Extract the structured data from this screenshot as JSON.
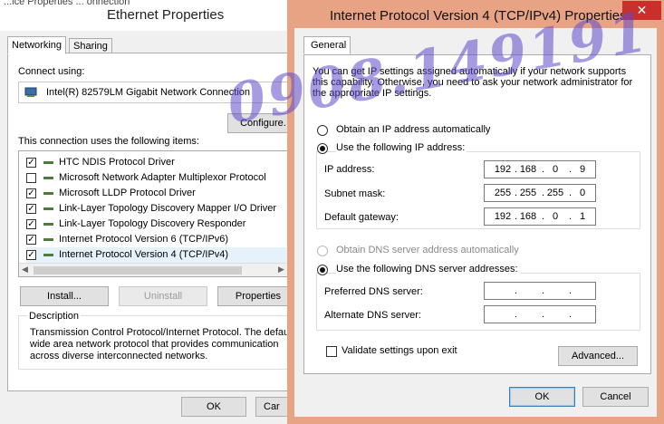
{
  "background_dialog": {
    "top_fragment": "...ice Properties ... onnection",
    "title": "Ethernet Properties",
    "tabs": [
      "Networking",
      "Sharing"
    ],
    "connect_using_label": "Connect using:",
    "adapter_name": "Intel(R) 82579LM Gigabit Network Connection",
    "configure_label": "Configure.",
    "items_label": "This connection uses the following items:",
    "items": [
      {
        "checked": true,
        "label": "HTC NDIS Protocol Driver"
      },
      {
        "checked": false,
        "label": "Microsoft Network Adapter Multiplexor Protocol"
      },
      {
        "checked": true,
        "label": "Microsoft LLDP Protocol Driver"
      },
      {
        "checked": true,
        "label": "Link-Layer Topology Discovery Mapper I/O Driver"
      },
      {
        "checked": true,
        "label": "Link-Layer Topology Discovery Responder"
      },
      {
        "checked": true,
        "label": "Internet Protocol Version 6 (TCP/IPv6)"
      },
      {
        "checked": true,
        "label": "Internet Protocol Version 4 (TCP/IPv4)"
      }
    ],
    "install_label": "Install...",
    "uninstall_label": "Uninstall",
    "properties_label": "Properties",
    "description_title": "Description",
    "description_text": "Transmission Control Protocol/Internet Protocol. The default wide area network protocol that provides communication across diverse interconnected networks.",
    "ok_label": "OK",
    "cancel_label": "Car"
  },
  "ipv4_dialog": {
    "title": "Internet Protocol Version 4 (TCP/IPv4) Properties",
    "close_glyph": "✕",
    "tab": "General",
    "intro": "You can get IP settings assigned automatically if your network supports this capability. Otherwise, you need to ask your network administrator for the appropriate IP settings.",
    "obtain_ip_auto": "Obtain an IP address automatically",
    "use_following_ip": "Use the following IP address:",
    "ip_address_label": "IP address:",
    "ip_address": [
      "192",
      "168",
      "0",
      "9"
    ],
    "subnet_label": "Subnet mask:",
    "subnet": [
      "255",
      "255",
      "255",
      "0"
    ],
    "gateway_label": "Default gateway:",
    "gateway": [
      "192",
      "168",
      "0",
      "1"
    ],
    "obtain_dns_auto": "Obtain DNS server address automatically",
    "use_following_dns": "Use the following DNS server addresses:",
    "preferred_dns_label": "Preferred DNS server:",
    "alternate_dns_label": "Alternate DNS server:",
    "validate_label": "Validate settings upon exit",
    "advanced_label": "Advanced...",
    "ok_label": "OK",
    "cancel_label": "Cancel"
  },
  "watermark": "0908.149191",
  "colors": {
    "dialog_border": "#e8a385",
    "close_button": "#c9302c",
    "watermark": "#5f4bc8"
  }
}
